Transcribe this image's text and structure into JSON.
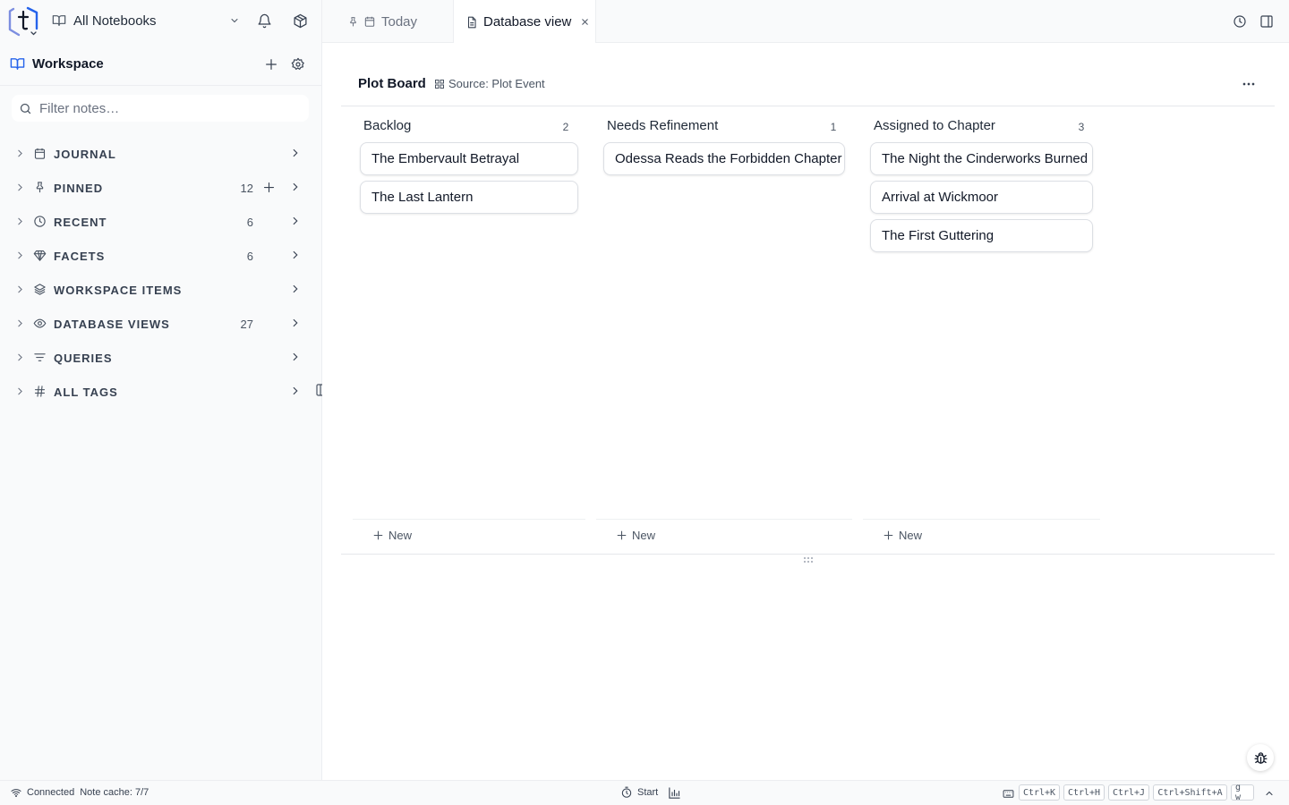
{
  "topbar": {
    "notebook_label": "All Notebooks"
  },
  "sidebar": {
    "workspace_title": "Workspace",
    "filter_placeholder": "Filter notes…",
    "sections": [
      {
        "label": "JOURNAL",
        "count": "",
        "icon": "calendar-icon"
      },
      {
        "label": "PINNED",
        "count": "12",
        "icon": "pin-icon"
      },
      {
        "label": "RECENT",
        "count": "6",
        "icon": "clock-icon"
      },
      {
        "label": "FACETS",
        "count": "6",
        "icon": "gem-icon"
      },
      {
        "label": "WORKSPACE ITEMS",
        "count": "",
        "icon": "layers-icon"
      },
      {
        "label": "DATABASE VIEWS",
        "count": "27",
        "icon": "eye-icon"
      },
      {
        "label": "QUERIES",
        "count": "",
        "icon": "filter-icon"
      },
      {
        "label": "ALL TAGS",
        "count": "",
        "icon": "hash-icon"
      }
    ]
  },
  "tabs": [
    {
      "label": "Today"
    },
    {
      "label": "Database view"
    }
  ],
  "board": {
    "title": "Plot Board",
    "source": "Source: Plot Event",
    "new_label": "New",
    "columns": [
      {
        "title": "Backlog",
        "count": "2",
        "cards": [
          "The Embervault Betrayal",
          "The Last Lantern"
        ]
      },
      {
        "title": "Needs Refinement",
        "count": "1",
        "cards": [
          "Odessa Reads the Forbidden Chapter"
        ]
      },
      {
        "title": "Assigned to Chapter",
        "count": "3",
        "cards": [
          "The Night the Cinderworks Burned",
          "Arrival at Wickmoor",
          "The First Guttering"
        ]
      }
    ]
  },
  "statusbar": {
    "connection": "Connected",
    "cache": "Note cache: 7/7",
    "start_label": "Start",
    "shortcuts": [
      "Ctrl+K",
      "Ctrl+H",
      "Ctrl+J",
      "Ctrl+Shift+A",
      "g w"
    ]
  },
  "colors": {
    "accent": "#2563eb",
    "sidebar_bg": "#f9fafb"
  }
}
